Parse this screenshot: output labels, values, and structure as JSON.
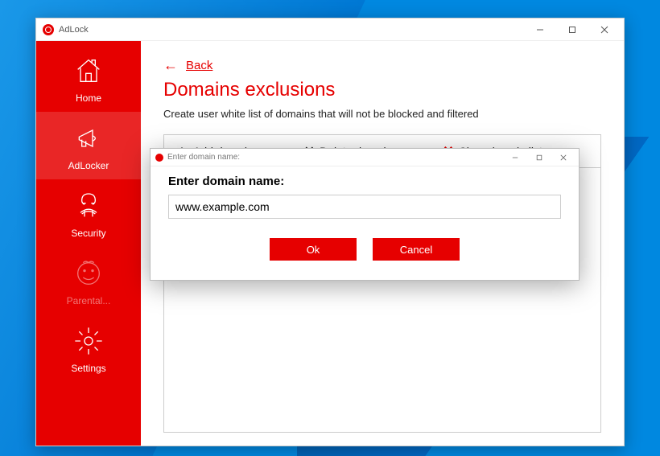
{
  "window": {
    "title": "AdLock"
  },
  "sidebar": {
    "items": [
      {
        "label": "Home"
      },
      {
        "label": "AdLocker"
      },
      {
        "label": "Security"
      },
      {
        "label": "Parental..."
      },
      {
        "label": "Settings"
      }
    ]
  },
  "content": {
    "back_label": "Back",
    "title": "Domains exclusions",
    "description": "Create user white list of domains that will not be blocked and filtered",
    "toolbar": {
      "add": "Add domain name",
      "delete": "Delete domain name",
      "clear": "Clear domain list"
    }
  },
  "dialog": {
    "title": "Enter domain name:",
    "label": "Enter domain name:",
    "input_value": "www.example.com",
    "ok": "Ok",
    "cancel": "Cancel"
  }
}
